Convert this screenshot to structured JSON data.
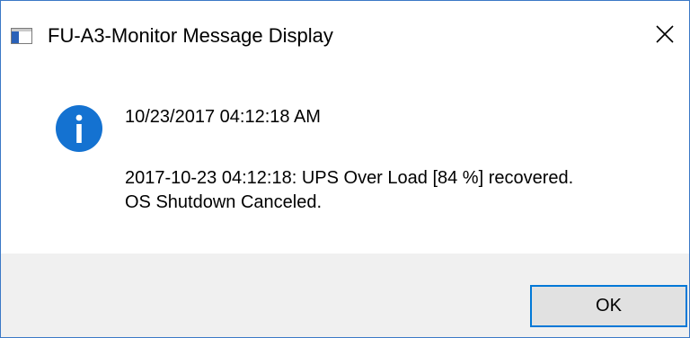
{
  "window": {
    "title": "FU-A3-Monitor Message Display",
    "app_icon": "window-app-icon",
    "close_icon": "close-icon"
  },
  "message": {
    "icon": "info-icon",
    "timestamp": "10/23/2017 04:12:18 AM",
    "lines": [
      "2017-10-23 04:12:18: UPS Over Load [84 %] recovered.",
      "OS Shutdown Canceled."
    ]
  },
  "buttons": {
    "ok_label": "OK"
  },
  "colors": {
    "accent": "#0078d7",
    "info_icon": "#1472d1",
    "footer_bg": "#f0f0f0",
    "border": "#3b79c6"
  }
}
